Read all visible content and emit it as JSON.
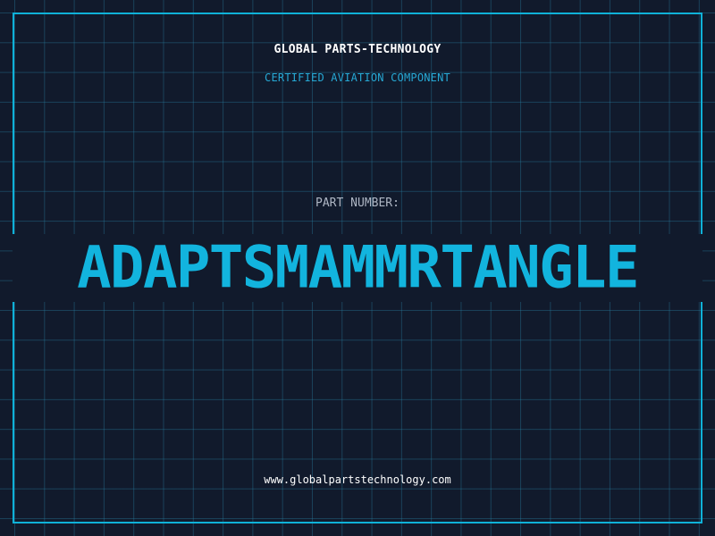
{
  "header": {
    "company_name": "GLOBAL PARTS-TECHNOLOGY",
    "subtitle": "CERTIFIED AVIATION COMPONENT"
  },
  "part": {
    "label": "PART NUMBER:",
    "number": "ADAPTSMAMMRTANGLE"
  },
  "footer": {
    "website": "www.globalpartstechnology.com"
  },
  "colors": {
    "background": "#111a2c",
    "accent": "#0fb1d8",
    "grid": "#1f6c8a",
    "text_primary": "#ffffff",
    "text_muted": "#aeb6c4"
  }
}
